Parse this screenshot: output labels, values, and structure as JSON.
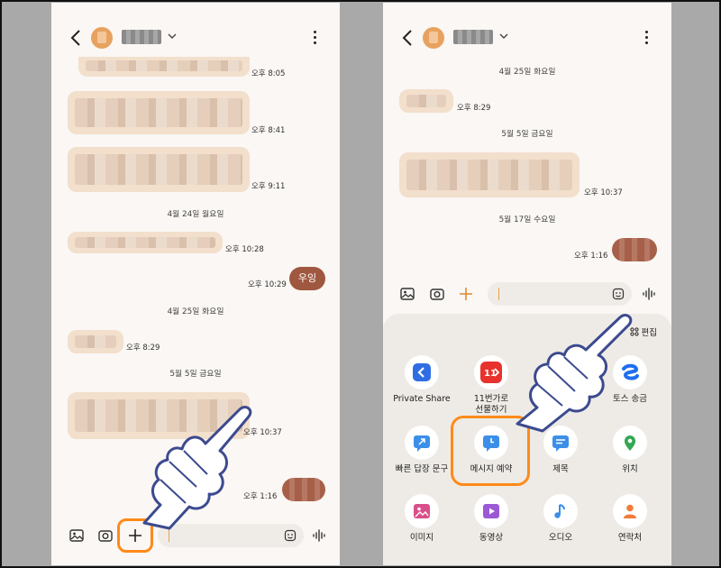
{
  "left": {
    "messages": [
      {
        "time": "오후 8:05"
      },
      {
        "time": "오후 8:41"
      },
      {
        "time": "오후 9:11"
      },
      {
        "date": "4월 24일 월요일"
      },
      {
        "time": "오후 10:28"
      },
      {
        "time": "오후 10:29",
        "text": "우잉"
      },
      {
        "date": "4월 25일 화요일"
      },
      {
        "time": "오후 8:29"
      },
      {
        "date": "5월 5일 금요일"
      },
      {
        "time": "오후 10:37"
      },
      {
        "time": "오후 1:16"
      }
    ]
  },
  "right": {
    "dates": [
      "4월 25일 화요일",
      "5월 5일 금요일",
      "5월 17일 수요일"
    ],
    "times": [
      "오후 8:29",
      "오후 10:37",
      "오후 1:16"
    ],
    "drawer": {
      "edit_label": "편집",
      "apps": [
        {
          "label": "Private Share",
          "icon": "private-share-icon",
          "color": "#2f6de3"
        },
        {
          "label": "11번가로\n선물하기",
          "icon": "11st-gift-icon",
          "color": "#e8322d"
        },
        {
          "label": "",
          "icon": "hidden-app-icon",
          "color": "#ffffff"
        },
        {
          "label": "토스 송금",
          "icon": "toss-icon",
          "color": "#1f6ef0"
        },
        {
          "label": "빠른 답장 문구",
          "icon": "quick-reply-icon",
          "color": "#3b8fe8"
        },
        {
          "label": "메시지 예약",
          "icon": "schedule-message-icon",
          "color": "#3b8fe8"
        },
        {
          "label": "제목",
          "icon": "subject-icon",
          "color": "#3b8fe8"
        },
        {
          "label": "위치",
          "icon": "location-icon",
          "color": "#35a853"
        },
        {
          "label": "이미지",
          "icon": "image-icon",
          "color": "#d94f8a"
        },
        {
          "label": "동영상",
          "icon": "video-icon",
          "color": "#9b59d6"
        },
        {
          "label": "오디오",
          "icon": "audio-icon",
          "color": "#3b8fe8"
        },
        {
          "label": "연락처",
          "icon": "contact-icon",
          "color": "#f07c3c"
        }
      ]
    }
  }
}
